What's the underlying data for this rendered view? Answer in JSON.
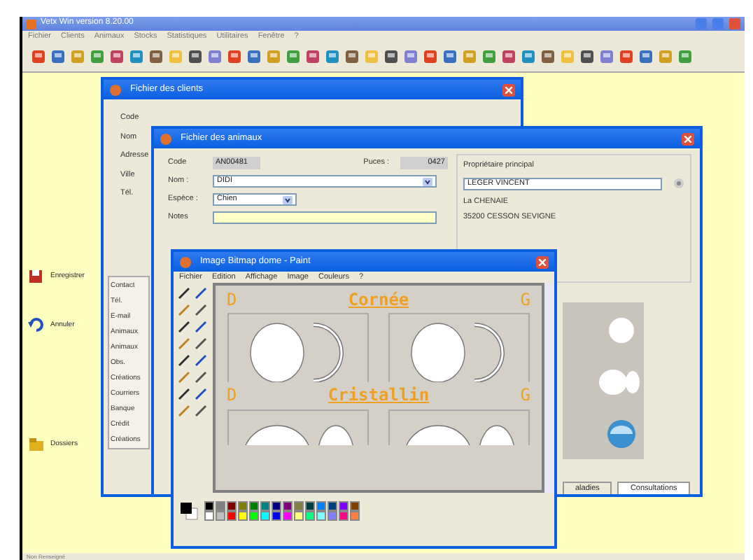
{
  "main_window": {
    "title": "Vetx Win version 8.20.00",
    "menu": [
      "Fichier",
      "Clients",
      "Animaux",
      "Stocks",
      "Statistiques",
      "Utilitaires",
      "Fenêtre",
      "?"
    ]
  },
  "side_buttons": [
    {
      "label": "Enregistrer",
      "kind": "save"
    },
    {
      "label": "Annuler",
      "kind": "undo"
    },
    {
      "label": "Dossiers",
      "kind": "folder"
    }
  ],
  "clients_window": {
    "title": "Fichier des clients",
    "fields": [
      "Code",
      "Nom",
      "Adresse",
      "Ville",
      "Tél."
    ],
    "list": [
      "Contact",
      "Tél.",
      "E-mail",
      "Animaux",
      "Animaux",
      "Obs.",
      "Créations",
      "Courriers",
      "Banque",
      "Crédit",
      "Créations"
    ]
  },
  "animals_window": {
    "title": "Fichier des animaux",
    "code_label": "Code",
    "code_value": "AN00481",
    "chip_label": "Puces :",
    "chip_value": "0427",
    "name_label": "Nom :",
    "name_value": "DIDI",
    "species_label": "Espèce :",
    "species_value": "Chien",
    "notes_label": "Notes",
    "owner_label": "Propriétaire principal",
    "owner_value": "LEGER VINCENT",
    "address_lines": [
      "La CHENAIE",
      "35200 CESSON SEVIGNE"
    ],
    "tabs": [
      {
        "label": "aladies",
        "selected": false
      },
      {
        "label": "Consultations",
        "selected": true
      }
    ]
  },
  "paint_window": {
    "title": "Image Bitmap dome - Paint",
    "menu": [
      "Fichier",
      "Edition",
      "Affichage",
      "Image",
      "Couleurs",
      "?"
    ],
    "sections": [
      {
        "left": "D",
        "title": "Cornée",
        "right": "G",
        "kind": "cornea"
      },
      {
        "left": "D",
        "title": "Cristallin",
        "right": "G",
        "kind": "lens"
      }
    ],
    "palette": [
      {
        "color": "#000000"
      },
      {
        "color": "#808080"
      },
      {
        "color": "#800000"
      },
      {
        "color": "#808000"
      },
      {
        "color": "#008000"
      },
      {
        "color": "#008080"
      },
      {
        "color": "#000080"
      },
      {
        "color": "#800080"
      },
      {
        "color": "#808040"
      },
      {
        "color": "#004040"
      },
      {
        "color": "#0080ff"
      },
      {
        "color": "#004080"
      },
      {
        "color": "#8000ff"
      },
      {
        "color": "#804000"
      },
      {
        "color": "#ffffff"
      },
      {
        "color": "#c0c0c0"
      },
      {
        "color": "#ff0000"
      },
      {
        "color": "#ffff00"
      },
      {
        "color": "#00ff00"
      },
      {
        "color": "#00ffff"
      },
      {
        "color": "#0000ff"
      },
      {
        "color": "#ff00ff"
      },
      {
        "color": "#ffff80"
      },
      {
        "color": "#00ff80"
      },
      {
        "color": "#80ffff"
      },
      {
        "color": "#8080ff"
      },
      {
        "color": "#ff0080"
      },
      {
        "color": "#ff8040"
      }
    ]
  },
  "status_bar": "Non Renseigné"
}
